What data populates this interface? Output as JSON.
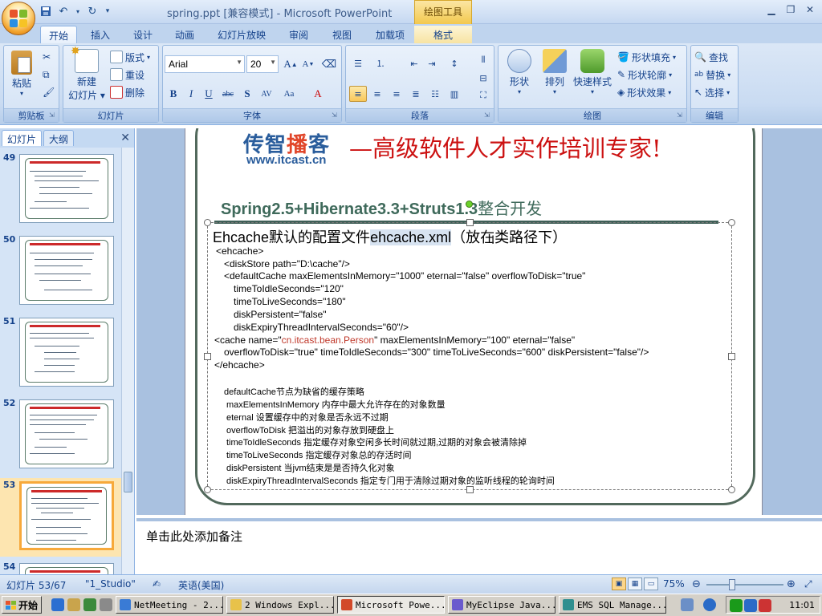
{
  "window": {
    "title": "spring.ppt [兼容模式] - Microsoft PowerPoint",
    "context_tab_group": "绘图工具"
  },
  "ribbon_tabs": [
    "开始",
    "插入",
    "设计",
    "动画",
    "幻灯片放映",
    "审阅",
    "视图",
    "加载项",
    "格式"
  ],
  "active_tab": "开始",
  "ribbon": {
    "clipboard": {
      "paste": "粘贴",
      "label": "剪贴板"
    },
    "slides": {
      "new_slide": "新建",
      "new_slide2": "幻灯片",
      "layout": "版式",
      "reset": "重设",
      "delete": "删除",
      "label": "幻灯片"
    },
    "font": {
      "font_name": "Arial",
      "font_size": "20",
      "label": "字体"
    },
    "paragraph": {
      "label": "段落"
    },
    "drawing": {
      "shapes": "形状",
      "arrange": "排列",
      "quick_styles": "快速样式",
      "shape_fill": "形状填充",
      "shape_outline": "形状轮廓",
      "shape_effects": "形状效果",
      "label": "绘图"
    },
    "editing": {
      "find": "查找",
      "replace": "替换",
      "select": "选择",
      "label": "编辑"
    }
  },
  "left_panel": {
    "tabs": [
      "幻灯片",
      "大纲"
    ],
    "thumbnails": [
      "49",
      "50",
      "51",
      "52",
      "53",
      "54"
    ],
    "selected": "53"
  },
  "slide": {
    "brand_a": "传智",
    "brand_b": "播",
    "brand_c": "客",
    "brand_url": "www.itcast.cn",
    "slogan": "—高级软件人才实作培训专家!",
    "title_en": "Spring2.5+Hibernate3.3+Struts1.3",
    "title_cn": "整合开发",
    "heading_prefix": "Ehcache默认的配置文件",
    "heading_file": "ehcache.xml",
    "heading_suffix": "（放在类路径下）",
    "code_lines": [
      "<ehcache>",
      "<diskStore path=\"D:\\cache\"/>",
      "<defaultCache  maxElementsInMemory=\"1000\"  eternal=\"false\" overflowToDisk=\"true\"",
      "timeToIdleSeconds=\"120\"",
      "timeToLiveSeconds=\"180\"",
      "diskPersistent=\"false\"",
      "diskExpiryThreadIntervalSeconds=\"60\"/>",
      "<cache name=\"",
      "cn.itcast.bean.Person",
      "\" maxElementsInMemory=\"100\" eternal=\"false\"",
      "overflowToDisk=\"true\" timeToIdleSeconds=\"300\" timeToLiveSeconds=\"600\" diskPersistent=\"false\"/>",
      "</ehcache>"
    ],
    "desc_lines": [
      "defaultCache节点为缺省的缓存策略",
      "maxElementsInMemory 内存中最大允许存在的对象数量",
      "eternal 设置缓存中的对象是否永远不过期",
      "overflowToDisk 把溢出的对象存放到硬盘上",
      "timeToIdleSeconds 指定缓存对象空闲多长时间就过期,过期的对象会被清除掉",
      "timeToLiveSeconds 指定缓存对象总的存活时间",
      "diskPersistent 当jvm结束是是否持久化对象",
      "diskExpiryThreadIntervalSeconds 指定专门用于清除过期对象的监听线程的轮询时间"
    ]
  },
  "notes": {
    "placeholder": "单击此处添加备注"
  },
  "status": {
    "slide_counter": "幻灯片 53/67",
    "theme": "\"1_Studio\"",
    "language": "英语(美国)",
    "zoom": "75%"
  },
  "taskbar": {
    "start": "开始",
    "tasks": [
      "NetMeeting - 2...",
      "2 Windows Expl...",
      "Microsoft Powe...",
      "MyEclipse Java...",
      "EMS SQL Manage..."
    ],
    "active_task": "Microsoft Powe...",
    "clock": "11:01"
  },
  "colors": {
    "ribbon_bg": "#c9dbf2",
    "accent_orange": "#f7a93a",
    "slogan_red": "#cc1111",
    "brand_blue": "#2a5d9c",
    "title_green": "#3f6a5b"
  }
}
